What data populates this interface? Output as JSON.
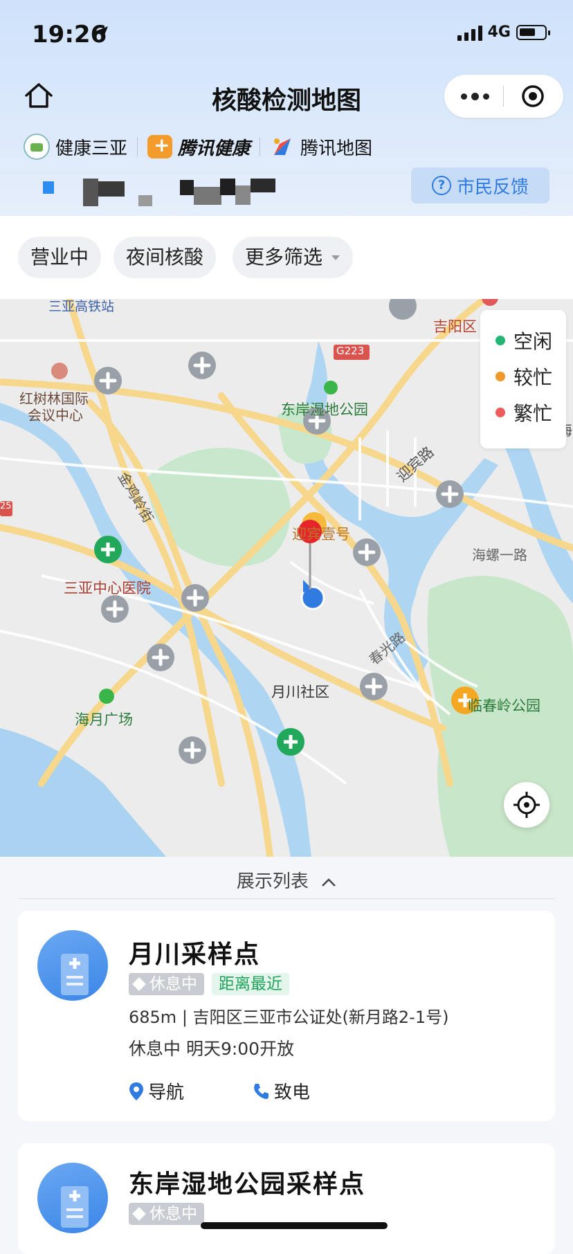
{
  "status_bar": {
    "time": "19:26",
    "network": "4G"
  },
  "header": {
    "title": "核酸检测地图",
    "brands": [
      "健康三亚",
      "腾讯健康",
      "腾讯地图"
    ],
    "feedback_label": "市民反馈"
  },
  "filters": [
    "营业中",
    "夜间核酸",
    "更多筛选"
  ],
  "map": {
    "legend": [
      {
        "label": "空闲",
        "color": "#22b573"
      },
      {
        "label": "较忙",
        "color": "#f0992b"
      },
      {
        "label": "繁忙",
        "color": "#ee5b5b"
      }
    ],
    "labels": {
      "station": "三亚高铁站",
      "jiyang": "吉阳区",
      "g223": "G223",
      "hongshulin": "红树林国际",
      "hongshulin2": "会议中心",
      "dongan_park": "东岸湿地公园",
      "jinji": "金鸡岭街",
      "yingbin_road": "迎宾路",
      "yingbin_one": "迎宾壹号",
      "hai": "海",
      "hailuo": "海螺一路",
      "hospital": "三亚中心医院",
      "chunguang": "春光路",
      "yuechuan": "月川社区",
      "haiyue": "海月广场",
      "linchun": "临春岭公园",
      "road25": "25"
    }
  },
  "list_toggle": "展示列表",
  "cards": [
    {
      "title": "月川采样点",
      "status": "休息中",
      "near_badge": "距离最近",
      "address": "685m | 吉阳区三亚市公证处(新月路2-1号)",
      "hours": "休息中 明天9:00开放",
      "nav_label": "导航",
      "call_label": "致电"
    },
    {
      "title": "东岸湿地公园采样点",
      "status": "休息中"
    }
  ]
}
